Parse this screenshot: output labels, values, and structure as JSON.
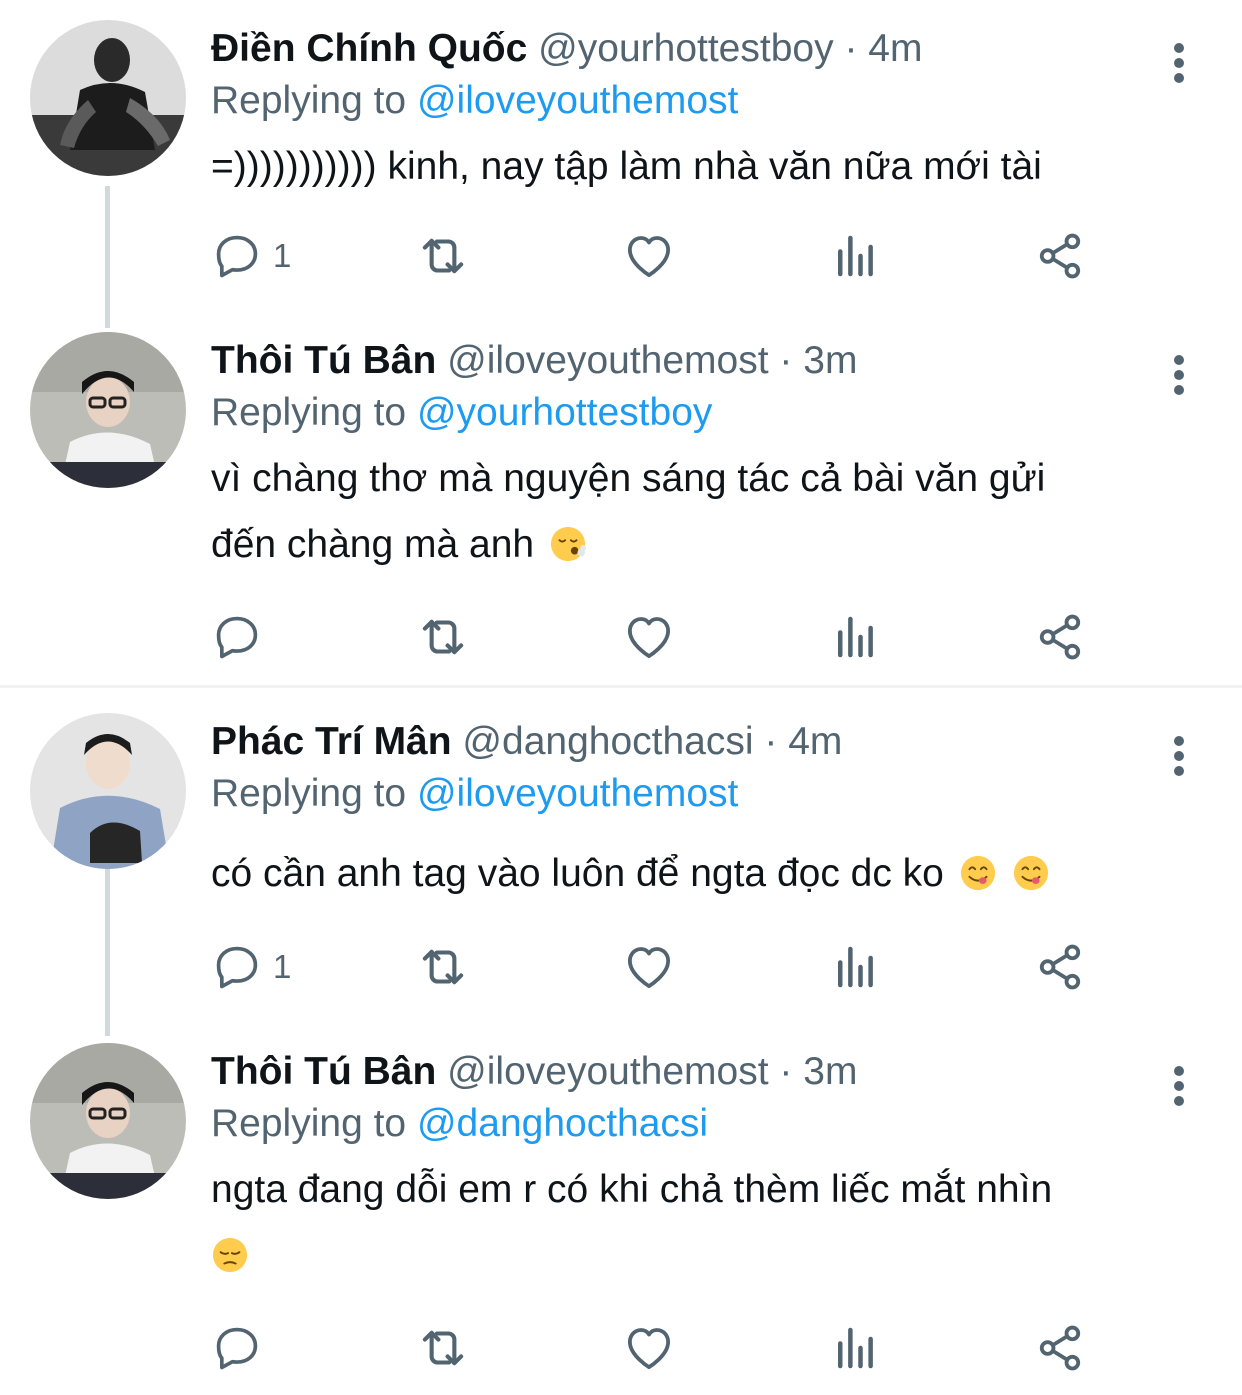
{
  "colors": {
    "text": "#0f1419",
    "secondary": "#536471",
    "mention": "#1d9bf0",
    "thread_line": "#cfd9de",
    "divider": "#eff3f4"
  },
  "tweets": [
    {
      "name": "Điền Chính Quốc",
      "handle": "@yourhottestboy",
      "dot": "·",
      "time": "4m",
      "replying_prefix": "Replying to",
      "replying_to": "@iloveyouthemost",
      "text_lines": [
        "=))))))))))) kinh, nay tập làm nhà văn nữa mới tài"
      ],
      "emojis": [],
      "reply_count": "1",
      "icons": [
        "reply-icon",
        "retweet-icon",
        "like-icon",
        "analytics-icon",
        "share-icon",
        "more-icon"
      ]
    },
    {
      "name": "Thôi Tú Bân",
      "handle": "@iloveyouthemost",
      "dot": "·",
      "time": "3m",
      "replying_prefix": "Replying to",
      "replying_to": "@yourhottestboy",
      "text_lines": [
        "vì chàng thơ mà nguyện sáng tác cả bài văn gửi",
        "đến chàng mà anh"
      ],
      "emojis": [
        "face-exhaling-emoji"
      ],
      "reply_count": "",
      "icons": [
        "reply-icon",
        "retweet-icon",
        "like-icon",
        "analytics-icon",
        "share-icon",
        "more-icon"
      ]
    },
    {
      "name": "Phác Trí Mân",
      "handle": "@danghocthacsi",
      "dot": "·",
      "time": "4m",
      "replying_prefix": "Replying to",
      "replying_to": "@iloveyouthemost",
      "text_lines": [
        "có cần anh tag vào luôn để ngta đọc dc ko"
      ],
      "emojis": [
        "yum-face-emoji",
        "yum-face-emoji"
      ],
      "reply_count": "1",
      "icons": [
        "reply-icon",
        "retweet-icon",
        "like-icon",
        "analytics-icon",
        "share-icon",
        "more-icon"
      ]
    },
    {
      "name": "Thôi Tú Bân",
      "handle": "@iloveyouthemost",
      "dot": "·",
      "time": "3m",
      "replying_prefix": "Replying to",
      "replying_to": "@danghocthacsi",
      "text_lines": [
        "ngta đang dỗi em r có khi chả thèm liếc mắt nhìn"
      ],
      "emojis": [
        "pensive-face-emoji"
      ],
      "reply_count": "",
      "icons": [
        "reply-icon",
        "retweet-icon",
        "like-icon",
        "analytics-icon",
        "share-icon",
        "more-icon"
      ]
    }
  ]
}
